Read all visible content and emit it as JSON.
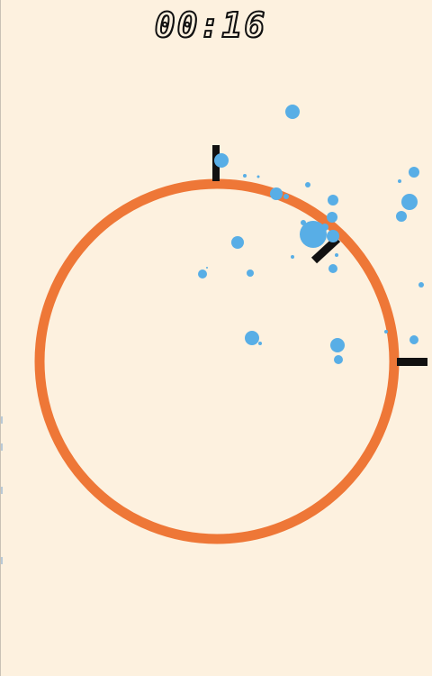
{
  "timer": "00:16",
  "colors": {
    "background": "#fdf1df",
    "ring": "#ee7737",
    "bubble": "#58aee6",
    "spike": "#111111"
  },
  "ring_shape": "circle",
  "spike_count": 3,
  "bubble_count": 32
}
